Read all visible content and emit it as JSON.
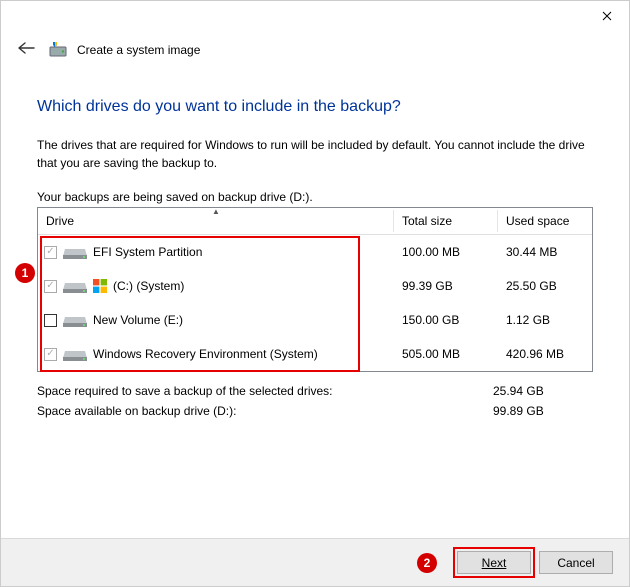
{
  "window": {
    "title": "Create a system image"
  },
  "heading": "Which drives do you want to include in the backup?",
  "description": "The drives that are required for Windows to run will be included by default. You cannot include the drive that you are saving the backup to.",
  "saving_label": "Your backups are being saved on backup drive (D:).",
  "columns": {
    "drive": "Drive",
    "total": "Total size",
    "used": "Used space"
  },
  "rows": [
    {
      "name": "EFI System Partition",
      "total": "100.00 MB",
      "used": "30.44 MB",
      "checked": true,
      "mandatory": true,
      "winlogo": false
    },
    {
      "name": "(C:) (System)",
      "total": "99.39 GB",
      "used": "25.50 GB",
      "checked": true,
      "mandatory": true,
      "winlogo": true
    },
    {
      "name": "New Volume (E:)",
      "total": "150.00 GB",
      "used": "1.12 GB",
      "checked": false,
      "mandatory": false,
      "winlogo": false
    },
    {
      "name": "Windows Recovery Environment (System)",
      "total": "505.00 MB",
      "used": "420.96 MB",
      "checked": true,
      "mandatory": true,
      "winlogo": false
    }
  ],
  "summary": {
    "required_label": "Space required to save a backup of the selected drives:",
    "required_value": "25.94 GB",
    "available_label": "Space available on backup drive (D:):",
    "available_value": "99.89 GB"
  },
  "buttons": {
    "next": "Next",
    "cancel": "Cancel"
  },
  "annotations": {
    "one": "1",
    "two": "2"
  }
}
